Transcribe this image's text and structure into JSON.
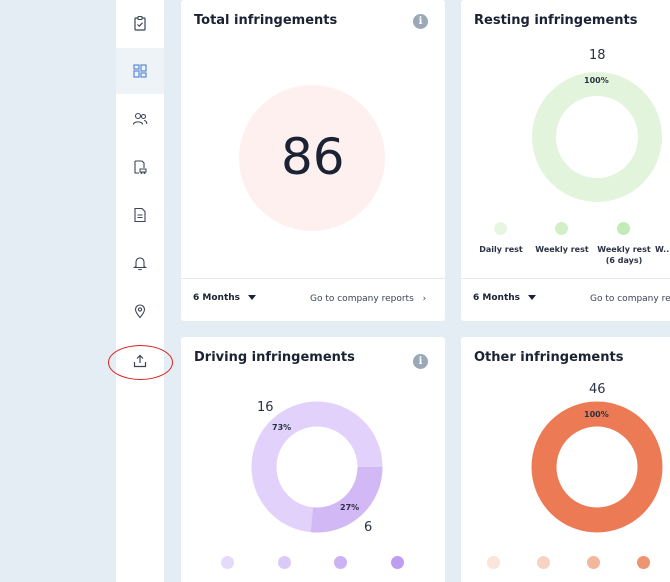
{
  "sidebar": {
    "items": [
      {
        "icon": "clipboard-check-icon"
      },
      {
        "icon": "dashboard-grid-icon",
        "active": true
      },
      {
        "icon": "users-icon"
      },
      {
        "icon": "vehicle-document-icon"
      },
      {
        "icon": "document-icon"
      },
      {
        "icon": "bell-icon"
      },
      {
        "icon": "location-pin-icon"
      },
      {
        "icon": "upload-icon"
      }
    ]
  },
  "cards": {
    "total": {
      "title": "Total infringements",
      "value": "86",
      "period": "6 Months",
      "link": "Go to company reports"
    },
    "resting": {
      "title": "Resting infringements",
      "value": "18",
      "percent": "100%",
      "legend": [
        "Daily rest",
        "Weekly rest",
        "Weekly rest (6 days)",
        "W... co..."
      ],
      "period": "6 Months",
      "link": "Go to company re"
    },
    "driving": {
      "title": "Driving infringements",
      "value_major": "16",
      "value_minor": "6",
      "percent_major": "73%",
      "percent_minor": "27%"
    },
    "other": {
      "title": "Other infringements",
      "value": "46",
      "percent": "100%"
    }
  },
  "colors": {
    "total_circle": "#fdf0ef",
    "resting_ring": "#e2f5dc",
    "driving_major": "#e2d1fa",
    "driving_minor": "#d2b8f5",
    "other_ring": "#ec7a55",
    "annotation": "#e02020"
  }
}
